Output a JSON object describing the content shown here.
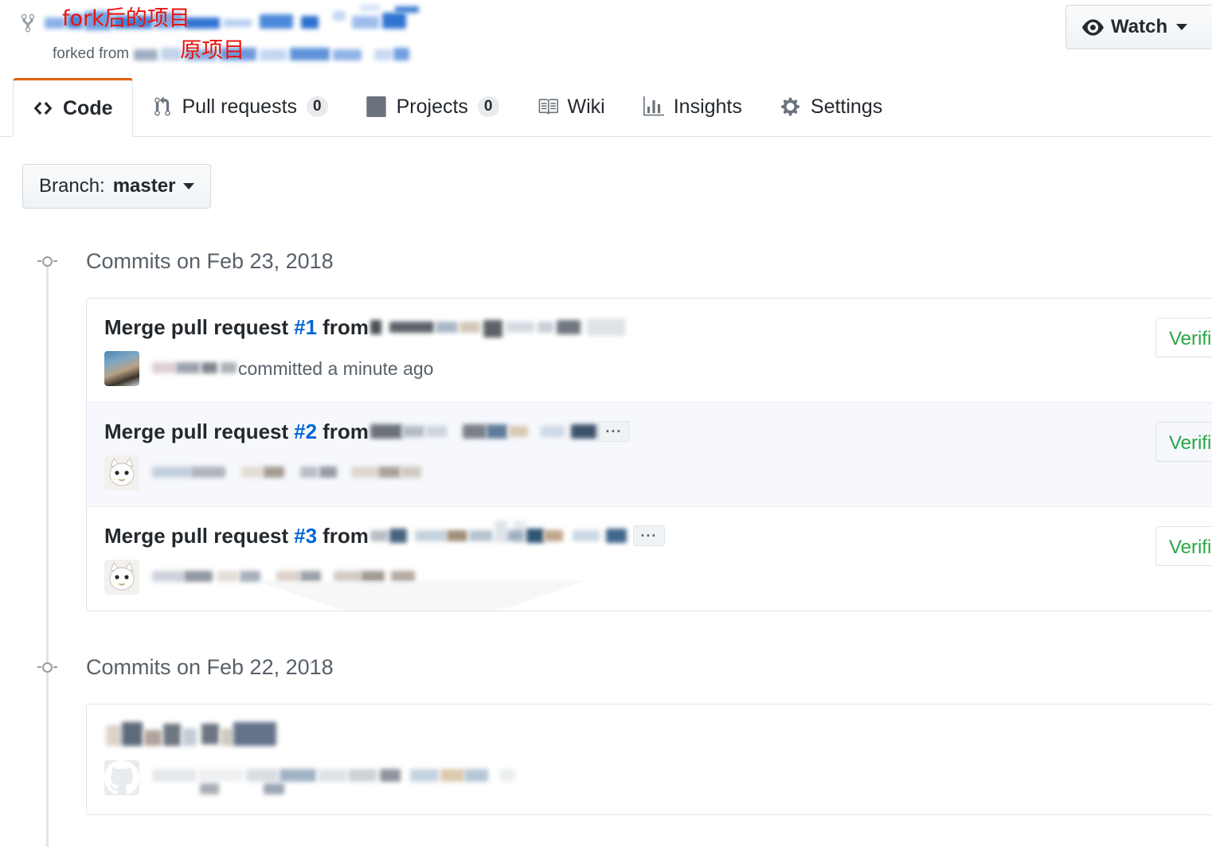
{
  "header": {
    "fork_icon": "repo-forked-icon",
    "repo_name_redacted": true,
    "forked_from_label": "forked from",
    "annotation_repo": "fork后的项目",
    "annotation_source": "原项目",
    "annotation_color": "#e8140c",
    "watch": {
      "label": "Watch",
      "icon": "eye-icon",
      "caret": "chevron-down-icon"
    }
  },
  "nav": {
    "tabs": [
      {
        "label": "Code",
        "icon": "code-icon",
        "count": null,
        "active": true
      },
      {
        "label": "Pull requests",
        "icon": "git-pull-request-icon",
        "count": "0",
        "active": false
      },
      {
        "label": "Projects",
        "icon": "project-board-icon",
        "count": "0",
        "active": false
      },
      {
        "label": "Wiki",
        "icon": "book-icon",
        "count": null,
        "active": false
      },
      {
        "label": "Insights",
        "icon": "graph-icon",
        "count": null,
        "active": false
      },
      {
        "label": "Settings",
        "icon": "gear-icon",
        "count": null,
        "active": false
      }
    ]
  },
  "branch": {
    "prefix": "Branch:",
    "name": "master",
    "caret": "chevron-down-icon"
  },
  "commit_groups": [
    {
      "date_label": "Commits on Feb 23, 2018",
      "commits": [
        {
          "title_prefix": "Merge pull request",
          "pr_number": "#1",
          "title_suffix": "from",
          "branch_redacted": true,
          "has_ellipsis": false,
          "author_redacted": true,
          "meta_text": "committed a minute ago",
          "avatar_kind": "photo-avatar",
          "verified_label": "Verified",
          "highlight": false
        },
        {
          "title_prefix": "Merge pull request",
          "pr_number": "#2",
          "title_suffix": "from",
          "branch_redacted": true,
          "has_ellipsis": true,
          "ellipsis_label": "···",
          "author_redacted": true,
          "meta_text": "",
          "avatar_kind": "cat-avatar",
          "verified_label": "Verified",
          "highlight": true
        },
        {
          "title_prefix": "Merge pull request",
          "pr_number": "#3",
          "title_suffix": "from",
          "branch_redacted": true,
          "has_ellipsis": true,
          "ellipsis_label": "···",
          "author_redacted": true,
          "meta_text": "",
          "avatar_kind": "cat-avatar",
          "verified_label": "Verified",
          "highlight": false
        }
      ]
    },
    {
      "date_label": "Commits on Feb 22, 2018",
      "commits": [
        {
          "title_prefix": "",
          "pr_number": "",
          "title_suffix": "",
          "branch_redacted": true,
          "has_ellipsis": false,
          "author_redacted": true,
          "meta_text": "",
          "avatar_kind": "octocat-avatar",
          "verified_label": "",
          "highlight": false
        }
      ]
    }
  ],
  "colors": {
    "accent_orange": "#e36209",
    "link_blue": "#0366d6",
    "verified_green": "#28a745",
    "text_primary": "#24292e",
    "text_muted": "#586069",
    "border": "#e1e4e8",
    "annotation_red": "#e8140c"
  }
}
